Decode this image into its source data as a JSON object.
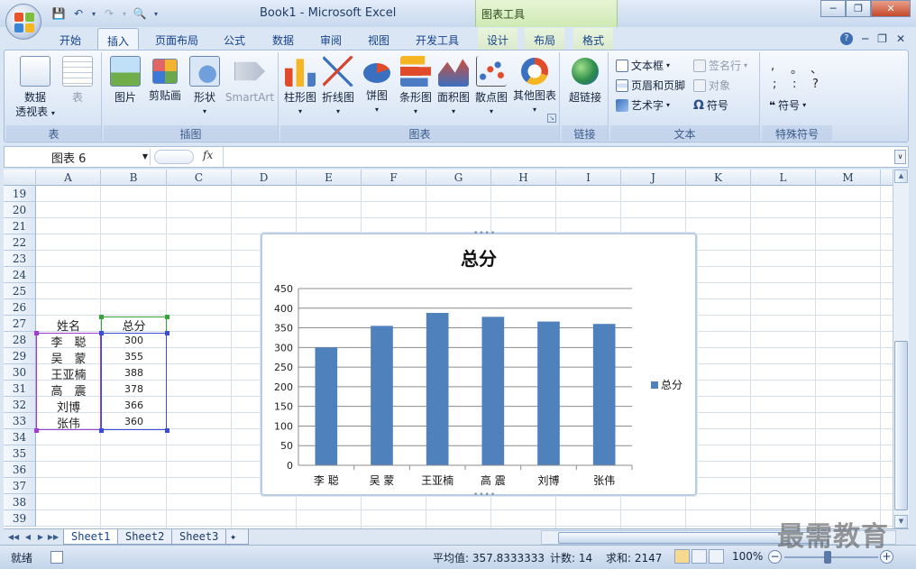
{
  "window": {
    "title": "Book1 - Microsoft Excel",
    "context_title": "图表工具"
  },
  "tabs": [
    {
      "label": "开始"
    },
    {
      "label": "插入"
    },
    {
      "label": "页面布局"
    },
    {
      "label": "公式"
    },
    {
      "label": "数据"
    },
    {
      "label": "审阅"
    },
    {
      "label": "视图"
    },
    {
      "label": "开发工具"
    },
    {
      "label": "设计"
    },
    {
      "label": "布局"
    },
    {
      "label": "格式"
    }
  ],
  "active_tab": "插入",
  "ribbon": {
    "table_group": {
      "label": "表",
      "pivot": "数据",
      "pivot2": "透视表",
      "table": "表"
    },
    "illus_group": {
      "label": "插图",
      "picture": "图片",
      "clipart": "剪贴画",
      "shapes": "形状",
      "smartart": "SmartArt"
    },
    "chart_group": {
      "label": "图表",
      "column": "柱形图",
      "line": "折线图",
      "pie": "饼图",
      "bar": "条形图",
      "area": "面积图",
      "scatter": "散点图",
      "other": "其他图表"
    },
    "link_group": {
      "label": "链接",
      "hyperlink": "超链接"
    },
    "text_group": {
      "label": "文本",
      "textbox": "文本框",
      "header_footer": "页眉和页脚",
      "wordart": "艺术字",
      "signature": "签名行",
      "object": "对象",
      "symbol": "符号"
    },
    "special_group": {
      "label": "特殊符号",
      "symbol": "符号",
      "marks": [
        ",",
        "。",
        "、",
        ";",
        ":",
        "?"
      ]
    }
  },
  "formula_bar": {
    "name_box": "图表 6",
    "fx": "fx",
    "formula": ""
  },
  "columns": [
    "A",
    "B",
    "C",
    "D",
    "E",
    "F",
    "G",
    "H",
    "I",
    "J",
    "K",
    "L",
    "M"
  ],
  "rows": [
    "19",
    "20",
    "21",
    "22",
    "23",
    "24",
    "25",
    "26",
    "27",
    "28",
    "29",
    "30",
    "31",
    "32",
    "33",
    "34",
    "35",
    "36",
    "37",
    "38",
    "39"
  ],
  "table": {
    "header": [
      "姓名",
      "总分"
    ],
    "rows": [
      [
        "李　聪",
        "300"
      ],
      [
        "吴　蒙",
        "355"
      ],
      [
        "王亚楠",
        "388"
      ],
      [
        "高　震",
        "378"
      ],
      [
        "刘博",
        "366"
      ],
      [
        "张伟",
        "360"
      ]
    ]
  },
  "chart_data": {
    "type": "bar",
    "title": "总分",
    "categories": [
      "李 聪",
      "吴 蒙",
      "王亚楠",
      "高 震",
      "刘博",
      "张伟"
    ],
    "series": [
      {
        "name": "总分",
        "values": [
          300,
          355,
          388,
          378,
          366,
          360
        ],
        "color": "#4f81bd"
      }
    ],
    "ylim": [
      0,
      450
    ],
    "yticks": [
      "0",
      "50",
      "100",
      "150",
      "200",
      "250",
      "300",
      "350",
      "400",
      "450"
    ],
    "grid": true,
    "legend": "right"
  },
  "sheet_tabs": [
    "Sheet1",
    "Sheet2",
    "Sheet3"
  ],
  "status": {
    "ready": "就绪",
    "average": "平均值: 357.8333333",
    "count": "计数: 14",
    "sum": "求和: 2147",
    "zoom": "100%"
  },
  "watermark": "最需教育",
  "colors": {
    "accent": "#15428b",
    "bar": "#4f81bd"
  }
}
